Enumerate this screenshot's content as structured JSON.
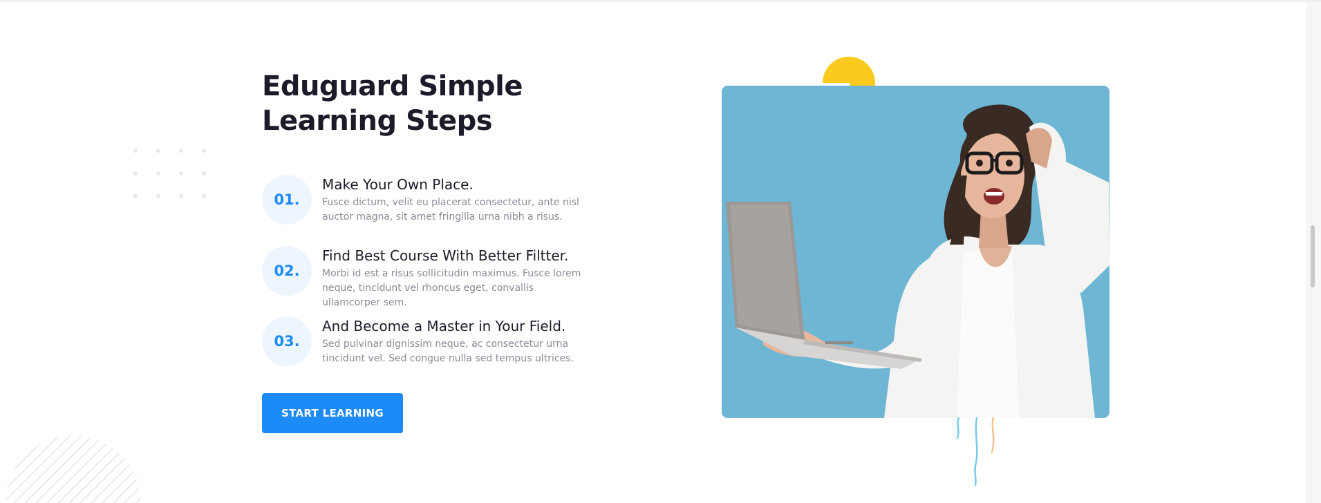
{
  "section": {
    "heading": "Eduguard Simple Learning Steps",
    "steps": [
      {
        "number": "01.",
        "title": "Make Your Own Place.",
        "description": "Fusce dictum, velit eu placerat consectetur, ante nisl auctor magna, sit amet fringilla urna nibh a risus."
      },
      {
        "number": "02.",
        "title": "Find Best Course With Better Filtter.",
        "description": "Morbi id est a risus sollicitudin maximus. Fusce lorem neque, tincidunt vel rhoncus eget, convallis ullamcorper sem."
      },
      {
        "number": "03.",
        "title": "And Become a Master in Your Field.",
        "description": "Sed pulvinar dignissim neque, ac consectetur urna tincidunt vel. Sed congue nulla sed tempus ultrices."
      }
    ],
    "cta_label": "START LEARNING"
  },
  "colors": {
    "accent": "#1c8bf7",
    "heading": "#1c1b29",
    "body_text": "#8a8a99",
    "number_circle_bg": "#edf5fe",
    "yellow_shape": "#fcca1f",
    "photo_bg": "#6ab3d2"
  },
  "icons": {
    "decor_dots": "dot-grid",
    "decor_stripes": "diagonal-stripes",
    "decor_yellow": "pac-shape",
    "decor_streaks": "colored-streaks"
  }
}
